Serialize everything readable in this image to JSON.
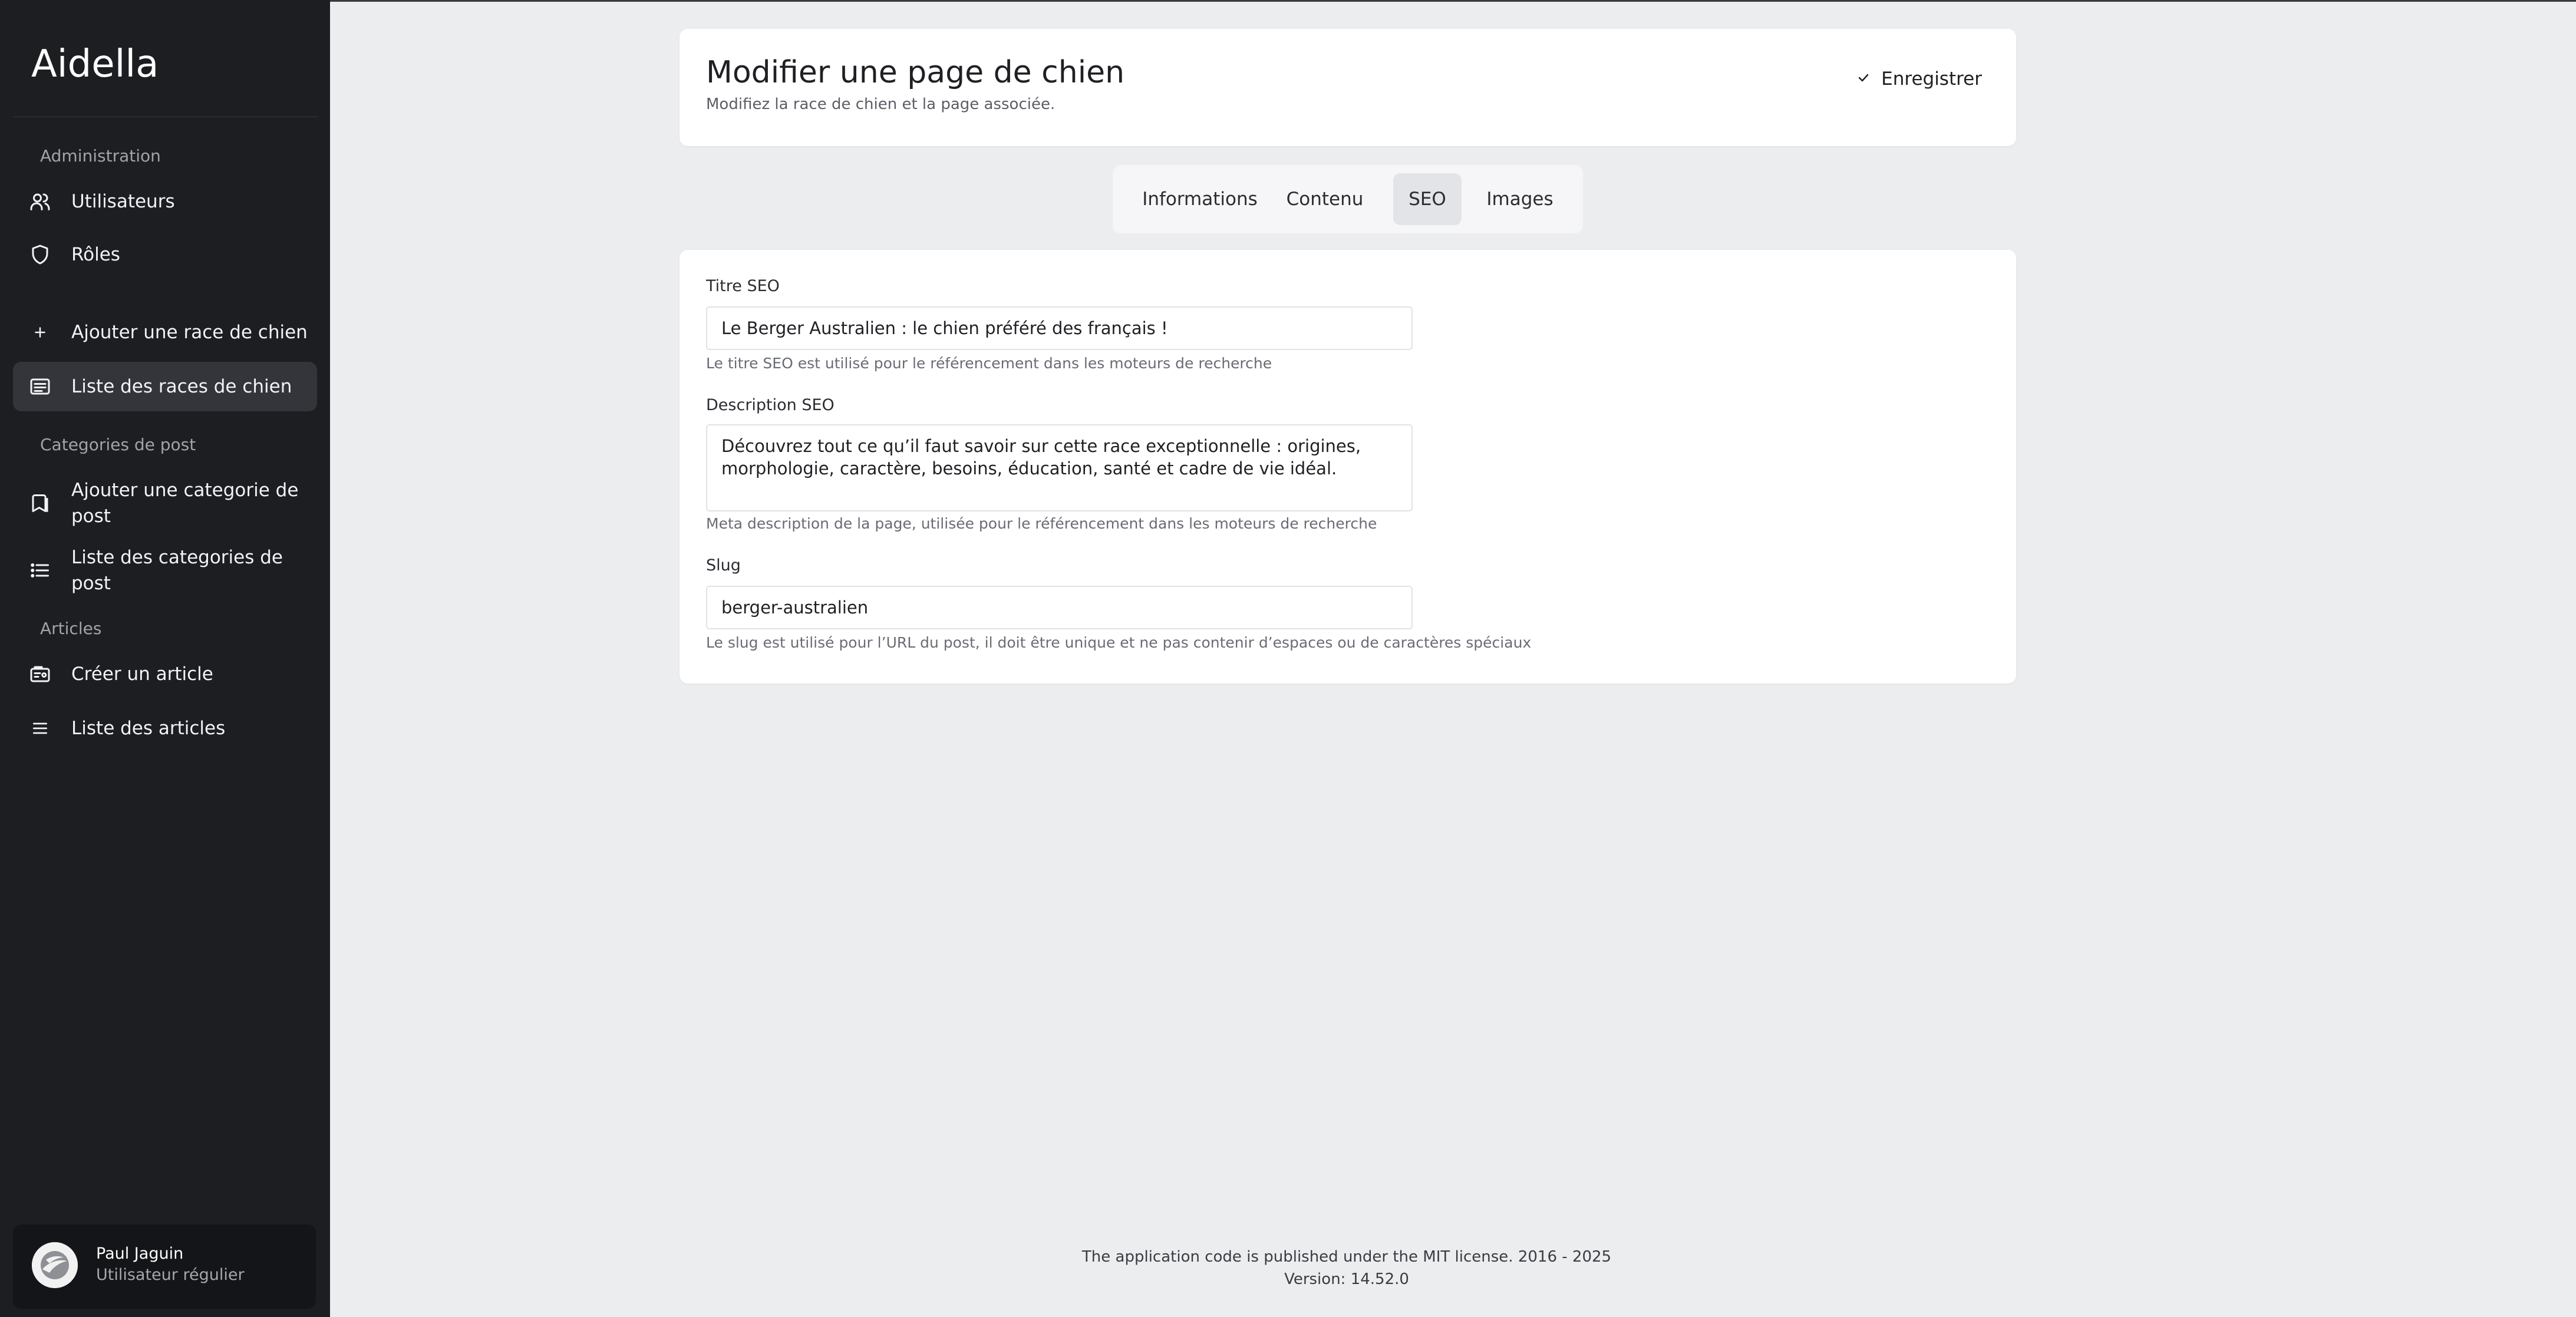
{
  "app": {
    "brand": "Aidella"
  },
  "sidebar": {
    "sections": {
      "administration": "Administration",
      "post_categories": "Categories de post",
      "articles": "Articles"
    },
    "items": [
      {
        "label": "Utilisateurs",
        "icon": "users-icon"
      },
      {
        "label": "Rôles",
        "icon": "shield-icon"
      },
      {
        "label": "Ajouter une race de chien",
        "icon": "plus-icon"
      },
      {
        "label": "Liste des races de chien",
        "icon": "list-box-icon",
        "active": true
      },
      {
        "label": "Ajouter une categorie de post",
        "icon": "bookmark-icon"
      },
      {
        "label": "Liste des categories de post",
        "icon": "list-icon"
      },
      {
        "label": "Créer un article",
        "icon": "article-icon"
      },
      {
        "label": "Liste des articles",
        "icon": "menu-icon"
      }
    ],
    "user": {
      "name": "Paul Jaguin",
      "role": "Utilisateur régulier"
    }
  },
  "header": {
    "title": "Modifier une page de chien",
    "subtitle": "Modifiez la race de chien et la page associée.",
    "save_label": "Enregistrer"
  },
  "tabs": [
    {
      "label": "Informations"
    },
    {
      "label": "Contenu"
    },
    {
      "label": "SEO",
      "active": true
    },
    {
      "label": "Images"
    }
  ],
  "form": {
    "seo_title": {
      "label": "Titre SEO",
      "value": "Le Berger Australien : le chien préféré des français !",
      "help": "Le titre SEO est utilisé pour le référencement dans les moteurs de recherche"
    },
    "seo_description": {
      "label": "Description SEO",
      "value": "Découvrez tout ce qu’il faut savoir sur cette race exceptionnelle : origines, morphologie, caractère, besoins, éducation, santé et cadre de vie idéal.",
      "help": "Meta description de la page, utilisée pour le référencement dans les moteurs de recherche"
    },
    "slug": {
      "label": "Slug",
      "value": "berger-australien",
      "help": "Le slug est utilisé pour l’URL du post, il doit être unique et ne pas contenir d’espaces ou de caractères spéciaux"
    }
  },
  "footer": {
    "license": "The application code is published under the MIT license. 2016 - 2025",
    "version": "Version: 14.52.0"
  }
}
